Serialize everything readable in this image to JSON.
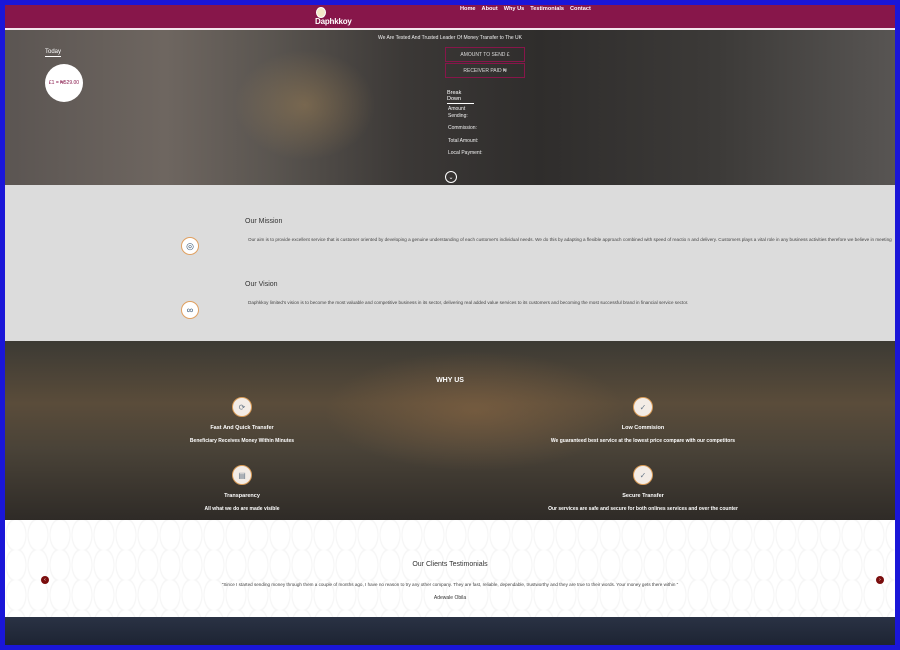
{
  "colors": {
    "brand": "#87164a",
    "frame": "#1a16d8",
    "mission_bg": "#dcdcdc"
  },
  "header": {
    "brand": "Daphkkoy",
    "nav": [
      "Home",
      "About",
      "Why Us",
      "Testimonials",
      "Contact"
    ]
  },
  "hero": {
    "tagline": "We Are Tested And Trusted Leader Of Money Transfer to The UK",
    "today_label": "Today",
    "rate": "£1 = ₦529.00",
    "amount_placeholder": "AMOUNT TO SEND  £",
    "receiver_placeholder": "RECEIVER PAID  ₦",
    "breakdown_label": "Break Down",
    "breakdown_rows": [
      "Amount",
      "Sending:",
      "Commission:",
      "Total Amount:",
      "Local Payment:"
    ]
  },
  "mission": {
    "mission_title": "Our Mission",
    "mission_text": "Our aim is to provide excellent service that is customer oriented by developing a genuine understanding of each customer's individual needs. We do this by adapting a flexible approach combined with speed of reactio n and delivery. Customers plays a vital role in any business activities therefore we believe in meeting their needs",
    "vision_title": "Our Vision",
    "vision_text": "Daphkkoy limited's vision is to become the most valuable and competitive business in its sector, delivering real added value services to its customers and becoming the most successful brand in financial service sector."
  },
  "why": {
    "title": "WHY US",
    "items": [
      {
        "title": "Fast And Quick Transfer",
        "text": "Beneficiary Receives Money Within Minutes"
      },
      {
        "title": "Low Commision",
        "text": "We guaranteed best service at the lowest price compare with our competitors"
      },
      {
        "title": "Transparency",
        "text": "All what we do are made visible"
      },
      {
        "title": "Secure Transfer",
        "text": "Our services are safe and secure for both onlines services and over the counter"
      }
    ]
  },
  "testimonials": {
    "title": "Our Clients Testimonials",
    "quote": "\"Since I started sending money through them a couple of months ago, I have no reason to try any other company. They are fast, reliable, dependable, trustworthy and they are true to their words. Your money gets there within \"",
    "author": "Adewale Obila"
  }
}
